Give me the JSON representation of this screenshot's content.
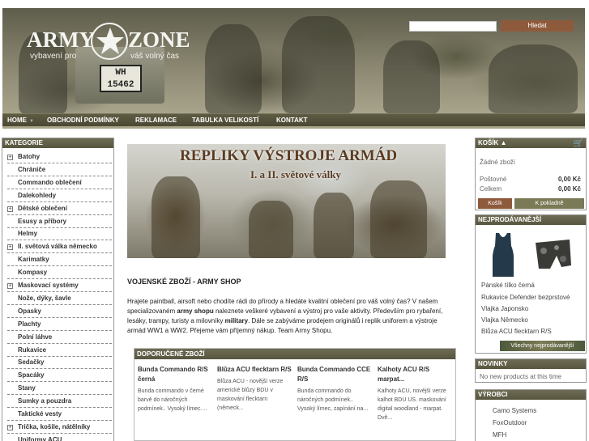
{
  "header": {
    "logo": {
      "left": "ARMY",
      "right": "ZONE",
      "tagline_left": "vybavení pro",
      "tagline_right": "váš volný čas"
    },
    "plate_lines": [
      "WH",
      "15462"
    ],
    "search": {
      "placeholder": "",
      "button_label": "Hledat"
    }
  },
  "nav": {
    "items": [
      {
        "label": "HOME",
        "has_dropdown": true
      },
      {
        "label": "OBCHODNÍ PODMÍNKY"
      },
      {
        "label": "REKLAMACE"
      },
      {
        "label": "TABULKA VELIKOSTÍ"
      },
      {
        "label": "KONTAKT"
      }
    ]
  },
  "sidebar": {
    "title": "KATEGORIE",
    "items": [
      {
        "label": "Batohy",
        "expandable": true
      },
      {
        "label": "Chrániče",
        "expandable": false
      },
      {
        "label": "Commando oblečení",
        "expandable": false
      },
      {
        "label": "Dalekohledy",
        "expandable": false
      },
      {
        "label": "Dětské oblečení",
        "expandable": true
      },
      {
        "label": "Esusy a příbory",
        "expandable": false
      },
      {
        "label": "Helmy",
        "expandable": false
      },
      {
        "label": "II. světová válka německo",
        "expandable": true
      },
      {
        "label": "Karimatky",
        "expandable": false
      },
      {
        "label": "Kompasy",
        "expandable": false
      },
      {
        "label": "Maskovací systémy",
        "expandable": true
      },
      {
        "label": "Nože, dýky, šavle",
        "expandable": false
      },
      {
        "label": "Opasky",
        "expandable": false
      },
      {
        "label": "Plachty",
        "expandable": false
      },
      {
        "label": "Polní láhve",
        "expandable": false
      },
      {
        "label": "Rukavice",
        "expandable": false
      },
      {
        "label": "Sedačky",
        "expandable": false
      },
      {
        "label": "Spacáky",
        "expandable": false
      },
      {
        "label": "Stany",
        "expandable": false
      },
      {
        "label": "Sumky a pouzdra",
        "expandable": false
      },
      {
        "label": "Taktické vesty",
        "expandable": false
      },
      {
        "label": "Trička, košile, nátělníky",
        "expandable": true
      },
      {
        "label": "Uniformy ACU",
        "expandable": false
      }
    ]
  },
  "banner": {
    "title": "REPLIKY VÝSTROJE ARMÁD",
    "subtitle": "I. a II. světové války"
  },
  "main": {
    "title": "VOJENSKÉ ZBOŽÍ - ARMY SHOP",
    "intro_1": "Hrajete paintball, airsoft nebo chodíte rádi do přírody a hledáte kvalitní oblečení pro váš volný čas? V našem specializovaném ",
    "intro_bold_1": "army shopu",
    "intro_2": " naleznete veškeré vybavení a výstroj pro vaše aktivity. Především pro rybaření, lesáky, trampy, turisty a milovníky ",
    "intro_bold_2": "military",
    "intro_3": ". Dále se zabýváme prodejem originálů i replik uniforem a výstroje armád WW1 a WW2. Přejeme vám příjemný nákup. Team Army Shopu."
  },
  "recommended": {
    "title": "DOPORUČENÉ ZBOŽÍ",
    "products": [
      {
        "title": "Bunda Commando R/S černá",
        "desc": "Bunda commando v černé barvě do náročných podmínek.. Vysoký límec...."
      },
      {
        "title": "Blůza ACU flecktarn R/S",
        "desc": "Blůza ACU - novější verze americké blůzy BDU v maskování flecktarn (německ..."
      },
      {
        "title": "Bunda Commando CCE R/S",
        "desc": "Bunda commando do náročných podmínek.. Vysoký límec, zapínání na..."
      },
      {
        "title": "Kalhoty ACU R/S marpat...",
        "desc": "Kalhoty ACU, novější verze kalhot BDU US. maskování digital woodland - marpat. Dvě..."
      }
    ]
  },
  "cart": {
    "title": "KOŠÍK",
    "icon": "cart-icon",
    "empty_text": "Žádné zboží",
    "postage_label": "Poštovné",
    "postage_value": "0,00 Kč",
    "total_label": "Celkem",
    "total_value": "0,00 Kč",
    "cart_button": "Košík",
    "checkout_button": "K pokladně"
  },
  "bestsellers": {
    "title": "NEJPRODÁVANĚJŠÍ",
    "items": [
      "Pánské tílko černá",
      "Rukavice Defender bezprstové",
      "Vlajka Japonsko",
      "Vlajka Německo",
      "Blůza ACU flecktarn R/S"
    ],
    "all_button": "Všechny nejprodávanější"
  },
  "news": {
    "title": "NOVINKY",
    "text": "No new products at this time"
  },
  "makers": {
    "title": "VÝROBCI",
    "items": [
      "Camo Systems",
      "FoxOutdoor",
      "MFH"
    ]
  },
  "colors": {
    "accent": "#58553f",
    "button": "#8e5a3c",
    "nav": "#4a4833"
  }
}
